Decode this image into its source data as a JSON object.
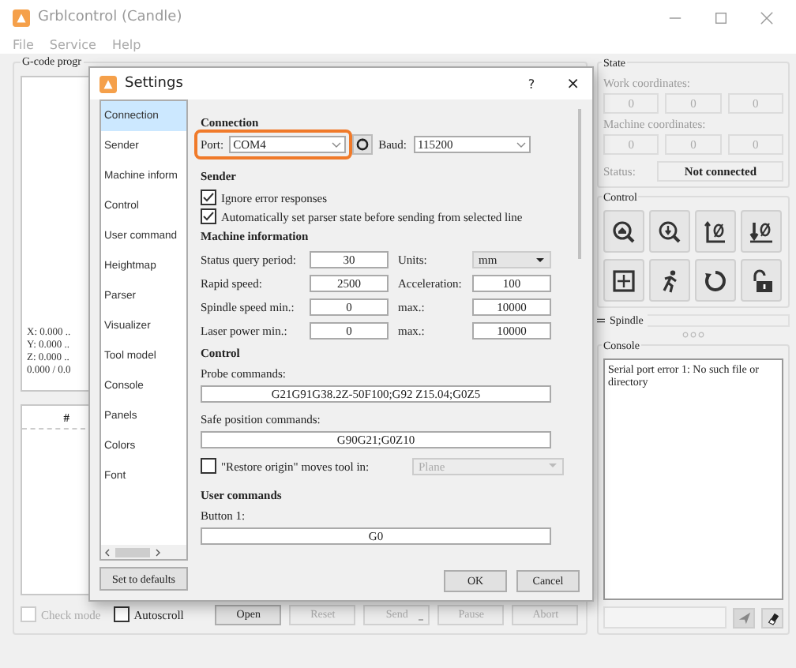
{
  "window": {
    "title": "Grblcontrol (Candle)"
  },
  "menu": [
    "File",
    "Service",
    "Help"
  ],
  "gcode_panel": {
    "title": "G-code progr",
    "coordinates": [
      "X: 0.000 ..",
      "Y: 0.000 ..",
      "Z: 0.000 ..",
      "0.000 / 0.0"
    ],
    "table": {
      "columns": [
        "#"
      ]
    },
    "check_mode": {
      "label": "Check mode",
      "checked": false,
      "disabled": true
    },
    "autoscroll": {
      "label": "Autoscroll",
      "checked": false,
      "disabled": false
    },
    "buttons": [
      {
        "label": "Open",
        "disabled": false
      },
      {
        "label": "Reset",
        "disabled": true
      },
      {
        "label": "Send",
        "disabled": true,
        "dropdown": true
      },
      {
        "label": "Pause",
        "disabled": true
      },
      {
        "label": "Abort",
        "disabled": true
      }
    ]
  },
  "state": {
    "title": "State",
    "work_label": "Work coordinates:",
    "work": [
      "0",
      "0",
      "0"
    ],
    "machine_label": "Machine coordinates:",
    "machine": [
      "0",
      "0",
      "0"
    ],
    "status_label": "Status:",
    "status": "Not connected"
  },
  "control": {
    "title": "Control"
  },
  "spindle": {
    "title": "Spindle"
  },
  "console": {
    "title": "Console",
    "output": "Serial port error 1: No such file or directory"
  },
  "settings_dialog": {
    "title": "Settings",
    "help": "?",
    "close": "×",
    "pages": [
      {
        "label": "Connection",
        "selected": true
      },
      {
        "label": "Sender",
        "selected": false
      },
      {
        "label": "Machine inform",
        "selected": false
      },
      {
        "label": "Control",
        "selected": false
      },
      {
        "label": "User command",
        "selected": false
      },
      {
        "label": "Heightmap",
        "selected": false
      },
      {
        "label": "Parser",
        "selected": false
      },
      {
        "label": "Visualizer",
        "selected": false
      },
      {
        "label": "Tool model",
        "selected": false
      },
      {
        "label": "Console",
        "selected": false
      },
      {
        "label": "Panels",
        "selected": false
      },
      {
        "label": "Colors",
        "selected": false
      },
      {
        "label": "Font",
        "selected": false
      }
    ],
    "defaults_button": "Set to defaults",
    "connection": {
      "heading": "Connection",
      "port_label": "Port:",
      "port": "COM4",
      "port_highlighted": true,
      "baud_label": "Baud:",
      "baud": "115200"
    },
    "sender": {
      "heading": "Sender",
      "options": [
        {
          "label": "Ignore error responses",
          "checked": true
        },
        {
          "label": "Automatically set parser state before sending from selected line",
          "checked": true
        }
      ]
    },
    "machine": {
      "heading": "Machine information",
      "rows": [
        {
          "label": "Status query period:",
          "value": "30",
          "label_2": "Units:",
          "field_2": {
            "kind": "combo",
            "value": "mm"
          }
        },
        {
          "label": "Rapid speed:",
          "value": "2500",
          "label_2": "Acceleration:",
          "field_2": {
            "kind": "input",
            "value": "100"
          }
        },
        {
          "label": "Spindle speed min.:",
          "value": "0",
          "label_2": "max.:",
          "field_2": {
            "kind": "input",
            "value": "10000"
          }
        },
        {
          "label": "Laser power min.:",
          "value": "0",
          "label_2": "max.:",
          "field_2": {
            "kind": "input",
            "value": "10000"
          }
        }
      ]
    },
    "control": {
      "heading": "Control",
      "probe_label": "Probe commands:",
      "probe": "G21G91G38.2Z-50F100;G92 Z15.04;G0Z5",
      "safe_label": "Safe position commands:",
      "safe": "G90G21;G0Z10",
      "restore": {
        "label": "\"Restore origin\" moves tool in:",
        "checked": false,
        "value": "Plane",
        "disabled": true
      }
    },
    "user_commands": {
      "heading": "User commands",
      "fields": [
        {
          "label": "Button 1:",
          "value": "G0"
        }
      ]
    },
    "buttons": [
      "OK",
      "Cancel"
    ]
  }
}
